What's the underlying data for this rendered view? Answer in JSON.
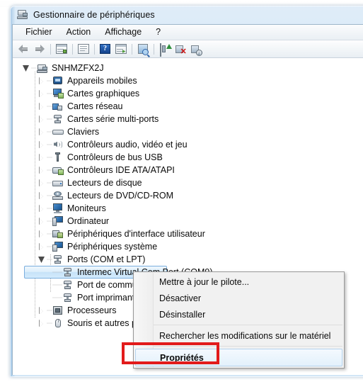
{
  "window": {
    "title": "Gestionnaire de périphériques",
    "icon": "device-manager-icon"
  },
  "menubar": {
    "items": [
      {
        "label": "Fichier",
        "name": "menu-fichier"
      },
      {
        "label": "Action",
        "name": "menu-action"
      },
      {
        "label": "Affichage",
        "name": "menu-affichage"
      },
      {
        "label": "?",
        "name": "menu-aide"
      }
    ]
  },
  "toolbar": {
    "buttons": [
      {
        "name": "back-arrow-icon",
        "title": "Précédent"
      },
      {
        "name": "forward-arrow-icon",
        "title": "Suivant"
      },
      {
        "name": "show-hide-console-tree-icon",
        "title": "Afficher/Masquer l'arborescence"
      },
      {
        "name": "properties-icon",
        "title": "Propriétés"
      },
      {
        "name": "help-icon",
        "title": "Aide"
      },
      {
        "name": "view-icon",
        "title": "Affichage"
      },
      {
        "name": "scan-hardware-changes-icon",
        "title": "Rechercher les modifications sur le matériel"
      },
      {
        "name": "update-driver-icon",
        "title": "Mettre à jour le pilote"
      },
      {
        "name": "disable-device-icon",
        "title": "Désactiver"
      },
      {
        "name": "enable-device-icon",
        "title": "Activer"
      }
    ]
  },
  "tree": {
    "root": {
      "label": "SNHMZFX2J",
      "icon": "computer-icon",
      "expanded": true
    },
    "items": [
      {
        "label": "Appareils mobiles",
        "icon": "mobile-device-icon",
        "expanded": false,
        "level": 1
      },
      {
        "label": "Cartes graphiques",
        "icon": "display-adapter-icon",
        "expanded": false,
        "level": 1
      },
      {
        "label": "Cartes réseau",
        "icon": "network-adapter-icon",
        "expanded": false,
        "level": 1
      },
      {
        "label": "Cartes série multi-ports",
        "icon": "multiport-serial-icon",
        "expanded": false,
        "level": 1
      },
      {
        "label": "Claviers",
        "icon": "keyboard-icon",
        "expanded": false,
        "level": 1
      },
      {
        "label": "Contrôleurs audio, vidéo et jeu",
        "icon": "sound-video-game-icon",
        "expanded": false,
        "level": 1
      },
      {
        "label": "Contrôleurs de bus USB",
        "icon": "usb-controller-icon",
        "expanded": false,
        "level": 1
      },
      {
        "label": "Contrôleurs IDE ATA/ATAPI",
        "icon": "ide-controller-icon",
        "expanded": false,
        "level": 1
      },
      {
        "label": "Lecteurs de disque",
        "icon": "disk-drive-icon",
        "expanded": false,
        "level": 1
      },
      {
        "label": "Lecteurs de DVD/CD-ROM",
        "icon": "dvd-drive-icon",
        "expanded": false,
        "level": 1
      },
      {
        "label": "Moniteurs",
        "icon": "monitor-icon",
        "expanded": false,
        "level": 1
      },
      {
        "label": "Ordinateur",
        "icon": "computer-node-icon",
        "expanded": false,
        "level": 1
      },
      {
        "label": "Périphériques d'interface utilisateur",
        "icon": "hid-device-icon",
        "expanded": false,
        "level": 1
      },
      {
        "label": "Périphériques système",
        "icon": "system-device-icon",
        "expanded": false,
        "level": 1
      },
      {
        "label": "Ports (COM et LPT)",
        "icon": "port-icon",
        "expanded": true,
        "level": 1
      },
      {
        "label": "Intermec Virtual Com Port (COM9)",
        "icon": "port-icon",
        "level": 2,
        "selected": true
      },
      {
        "label": "Port de commu",
        "icon": "port-icon",
        "level": 2,
        "truncated": true
      },
      {
        "label": "Port imprimante",
        "icon": "port-icon",
        "level": 2,
        "truncated": true
      },
      {
        "label": "Processeurs",
        "icon": "processor-icon",
        "expanded": false,
        "level": 1
      },
      {
        "label": "Souris et autres péri",
        "icon": "mouse-icon",
        "expanded": false,
        "level": 1,
        "truncated": true
      }
    ]
  },
  "context_menu": {
    "items": [
      {
        "label": "Mettre à jour le pilote...",
        "name": "ctx-update-driver",
        "bold": false,
        "highlighted": false
      },
      {
        "label": "Désactiver",
        "name": "ctx-disable",
        "bold": false,
        "highlighted": false
      },
      {
        "label": "Désinstaller",
        "name": "ctx-uninstall",
        "bold": false,
        "highlighted": false
      },
      {
        "label": "Rechercher les modifications sur le matériel",
        "name": "ctx-scan-hardware",
        "bold": false,
        "highlighted": false
      },
      {
        "label": "Propriétés",
        "name": "ctx-properties",
        "bold": true,
        "highlighted": true
      }
    ]
  },
  "annotation": {
    "highlight_color": "#e21b1b",
    "target": "Propriétés"
  }
}
